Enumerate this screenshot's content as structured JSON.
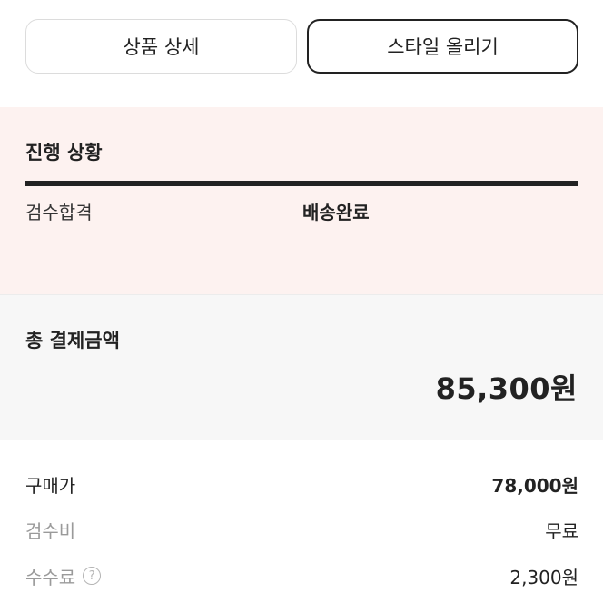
{
  "actions": {
    "product_detail_label": "상품 상세",
    "post_style_label": "스타일 올리기"
  },
  "progress": {
    "title": "진행 상황",
    "steps": [
      "검수합격",
      "배송완료"
    ],
    "current_step": "배송완료",
    "completion": 1.0
  },
  "payment": {
    "total_label": "총 결제금액",
    "total_amount": "85,300원"
  },
  "breakdown": {
    "items": [
      {
        "label": "구매가",
        "value": "78,000원"
      },
      {
        "label": "검수비",
        "value": "무료"
      },
      {
        "label": "수수료",
        "value": "2,300원",
        "help_icon": "question-circle-icon"
      }
    ]
  },
  "colors": {
    "progress_bg": "#fdf2f0",
    "total_bg": "#f7f7f7",
    "text": "#222222",
    "muted": "#9a9a9a"
  }
}
